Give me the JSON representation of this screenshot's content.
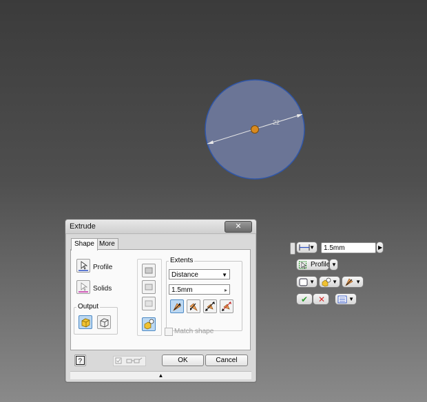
{
  "viewport": {
    "dimension_value": "22"
  },
  "dialog": {
    "title": "Extrude",
    "close_label": "✕",
    "tabs": [
      {
        "label": "Shape"
      },
      {
        "label": "More"
      }
    ],
    "profile_label": "Profile",
    "solids_label": "Solids",
    "output_title": "Output",
    "extents_title": "Extents",
    "extents_type": "Distance",
    "distance_value": "1.5mm",
    "match_shape_label": "Match shape",
    "ok_label": "OK",
    "cancel_label": "Cancel",
    "help_label": "?",
    "expand_glyph": "▲"
  },
  "mini_toolbar": {
    "distance_value": "1.5mm",
    "profile_label": "Profile",
    "ok_glyph": "✔",
    "cancel_glyph": "✕"
  },
  "colors": {
    "circle_fill": "#6b7596",
    "circle_stroke": "#2f56a8",
    "selected_button": "#bcd8f2",
    "ok_green": "#2d9a2d",
    "cancel_red": "#d62a2a"
  }
}
